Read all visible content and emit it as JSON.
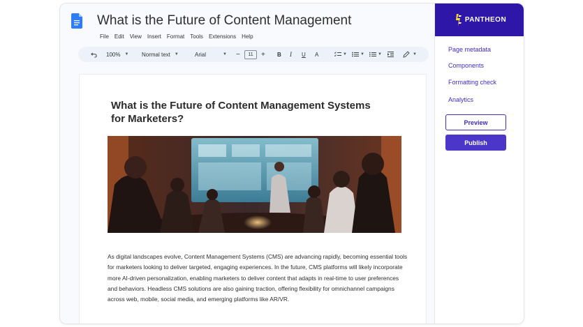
{
  "document": {
    "title": "What is the Future of Content Management",
    "menu": [
      "File",
      "Edit",
      "View",
      "Insert",
      "Format",
      "Tools",
      "Extensions",
      "Help"
    ],
    "toolbar": {
      "zoom": "100%",
      "style": "Normal text",
      "font": "Arial",
      "font_size": "11",
      "minus": "−",
      "plus": "+",
      "bold": "B",
      "italic": "I",
      "underline": "U",
      "text_color": "A"
    },
    "heading": "What is the Future of Content Management Systems for Marketers?",
    "body": "As digital landscapes evolve, Content Management Systems (CMS) are advancing rapidly, becoming essential tools for marketers looking to deliver targeted, engaging experiences. In the future, CMS platforms will likely incorporate more AI-driven personalization, enabling marketers to deliver content that adapts in real-time to user preferences and behaviors. Headless CMS solutions are also gaining traction, offering flexibility for omnichannel campaigns across web, mobile, social media, and emerging platforms like AR/VR."
  },
  "sidebar": {
    "brand": "PANTHEON",
    "brand_color": "#2e16a8",
    "nav": [
      "Page metadata",
      "Components",
      "Formatting check",
      "Analytics"
    ],
    "preview_label": "Preview",
    "publish_label": "Publish"
  }
}
